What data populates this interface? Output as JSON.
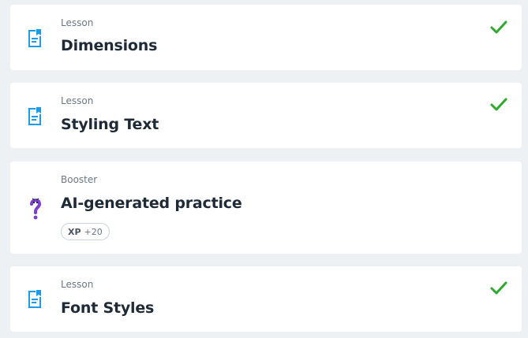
{
  "items": [
    {
      "kind": "Lesson",
      "title": "Dimensions",
      "icon": "lesson-document-icon",
      "completed": true
    },
    {
      "kind": "Lesson",
      "title": "Styling Text",
      "icon": "lesson-document-icon",
      "completed": true
    },
    {
      "kind": "Booster",
      "title": "AI-generated practice",
      "icon": "question-mark-icon",
      "completed": false,
      "xp": {
        "label": "XP",
        "value": "+20"
      }
    },
    {
      "kind": "Lesson",
      "title": "Font Styles",
      "icon": "lesson-document-icon",
      "completed": true
    }
  ],
  "colors": {
    "background": "#eef1f4",
    "card": "#ffffff",
    "lesson_icon": "#1e9be6",
    "booster_icon": "#7b3fd1",
    "check": "#2fa82f",
    "title": "#1f2a37",
    "muted": "#6b7785"
  }
}
